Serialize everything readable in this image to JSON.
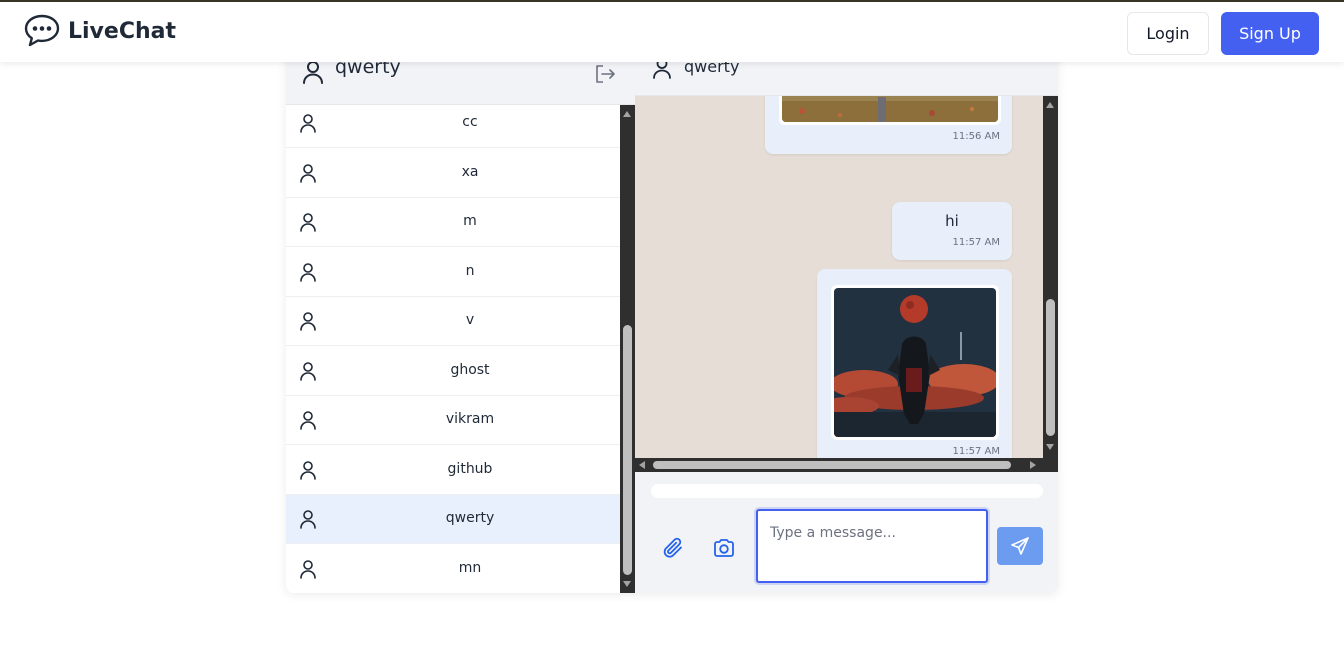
{
  "app": {
    "name": "LiveChat",
    "login_label": "Login",
    "signup_label": "Sign Up"
  },
  "sidebar": {
    "current_user": "qwerty",
    "users": [
      {
        "name": "cc",
        "active": false
      },
      {
        "name": "xa",
        "active": false
      },
      {
        "name": "m",
        "active": false
      },
      {
        "name": "n",
        "active": false
      },
      {
        "name": "v",
        "active": false
      },
      {
        "name": "ghost",
        "active": false
      },
      {
        "name": "vikram",
        "active": false
      },
      {
        "name": "github",
        "active": false
      },
      {
        "name": "qwerty",
        "active": true
      },
      {
        "name": "mn",
        "active": false
      }
    ]
  },
  "chat": {
    "contact_name": "qwerty",
    "messages": [
      {
        "type": "image",
        "time": "11:56 AM"
      },
      {
        "type": "text",
        "text": "hi",
        "time": "11:57 AM"
      },
      {
        "type": "image",
        "time": "11:57 AM"
      }
    ],
    "input_placeholder": "Type a message..."
  },
  "colors": {
    "primary": "#4460f1",
    "send_button": "#6b9cf0",
    "active_row": "#e9f0fd",
    "chat_background": "#e5ddd6",
    "bubble": "#e8eefa"
  }
}
